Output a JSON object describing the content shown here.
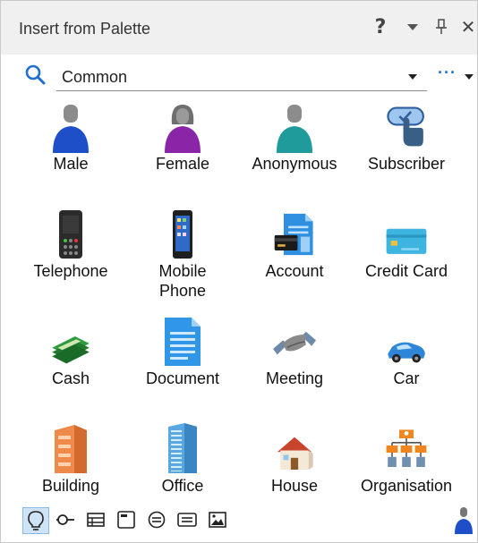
{
  "panel": {
    "title": "Insert from Palette"
  },
  "titlebar": {
    "help_glyph": "?",
    "pin_glyph": "⊥",
    "close_glyph": "✕",
    "icons": [
      "help-icon",
      "dropdown-icon",
      "pin-icon",
      "close-icon"
    ]
  },
  "search": {
    "category_value": "Common",
    "more_glyph": "···"
  },
  "palette": {
    "items": [
      {
        "label": "Male",
        "icon": "male-person-icon"
      },
      {
        "label": "Female",
        "icon": "female-person-icon"
      },
      {
        "label": "Anonymous",
        "icon": "anonymous-person-icon"
      },
      {
        "label": "Subscriber",
        "icon": "subscriber-icon"
      },
      {
        "label": "Telephone",
        "icon": "telephone-icon"
      },
      {
        "label": "Mobile Phone",
        "icon": "mobile-phone-icon"
      },
      {
        "label": "Account",
        "icon": "account-icon"
      },
      {
        "label": "Credit Card",
        "icon": "credit-card-icon"
      },
      {
        "label": "Cash",
        "icon": "cash-icon"
      },
      {
        "label": "Document",
        "icon": "document-icon"
      },
      {
        "label": "Meeting",
        "icon": "meeting-handshake-icon"
      },
      {
        "label": "Car",
        "icon": "car-icon"
      },
      {
        "label": "Building",
        "icon": "building-icon"
      },
      {
        "label": "Office",
        "icon": "office-tower-icon"
      },
      {
        "label": "House",
        "icon": "house-icon"
      },
      {
        "label": "Organisation",
        "icon": "organisation-chart-icon"
      }
    ]
  },
  "bottombar": {
    "icons": [
      "lightbulb-icon",
      "link-node-icon",
      "table-icon",
      "window-icon",
      "circle-lines-icon",
      "rectangle-lines-icon",
      "image-icon",
      "user-icon"
    ],
    "active_index": 0
  },
  "colors": {
    "accent": "#1f6fd1",
    "active_bg": "#cfe3f7",
    "titlebar_bg": "#f0f0f0"
  }
}
